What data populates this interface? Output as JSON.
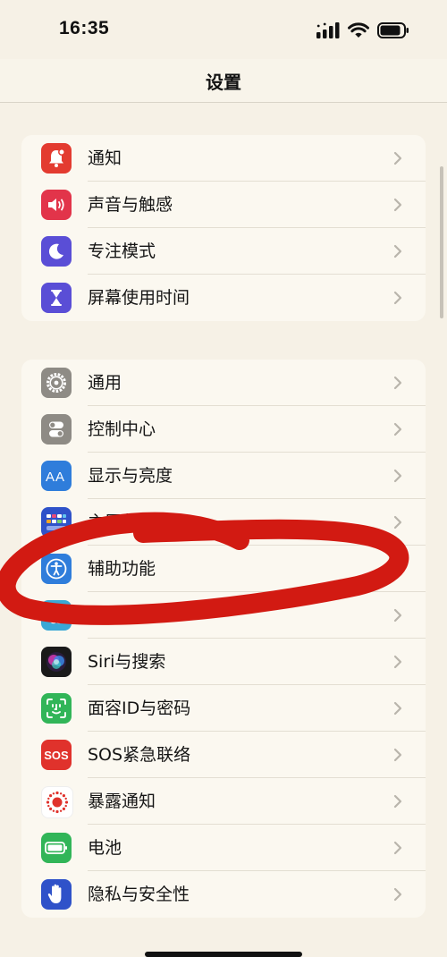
{
  "status": {
    "time": "16:35",
    "signal_icon": "cellular-signal-icon",
    "wifi_icon": "wifi-icon",
    "battery_icon": "battery-icon"
  },
  "nav": {
    "title": "设置"
  },
  "group1": [
    {
      "label": "通知",
      "icon": "bell-icon",
      "color": "#e33b30"
    },
    {
      "label": "声音与触感",
      "icon": "speaker-icon",
      "color": "#e2344a"
    },
    {
      "label": "专注模式",
      "icon": "moon-icon",
      "color": "#5a4ed6"
    },
    {
      "label": "屏幕使用时间",
      "icon": "hourglass-icon",
      "color": "#5a4ed6"
    }
  ],
  "group2": [
    {
      "label": "通用",
      "icon": "gear-icon",
      "color": "#8e8b85"
    },
    {
      "label": "控制中心",
      "icon": "toggles-icon",
      "color": "#8e8b85"
    },
    {
      "label": "显示与亮度",
      "icon": "text-size-icon",
      "color": "#2f7ddb"
    },
    {
      "label": "主屏幕",
      "icon": "home-grid-icon",
      "color": "#2f52c9"
    },
    {
      "label": "辅助功能",
      "icon": "accessibility-icon",
      "color": "#2f7ddb"
    },
    {
      "label": "墙纸",
      "icon": "wallpaper-flower-icon",
      "color": "#3aa8d6"
    },
    {
      "label": "Siri与搜索",
      "icon": "siri-icon",
      "color": "#1a1a1a"
    },
    {
      "label": "面容ID与密码",
      "icon": "face-id-icon",
      "color": "#31b558"
    },
    {
      "label": "SOS紧急联络",
      "icon": "sos-icon",
      "color": "#e0322c"
    },
    {
      "label": "暴露通知",
      "icon": "exposure-icon",
      "color": "#ffffff"
    },
    {
      "label": "电池",
      "icon": "battery-app-icon",
      "color": "#31b558"
    },
    {
      "label": "隐私与安全性",
      "icon": "hand-icon",
      "color": "#2f52c9"
    }
  ]
}
